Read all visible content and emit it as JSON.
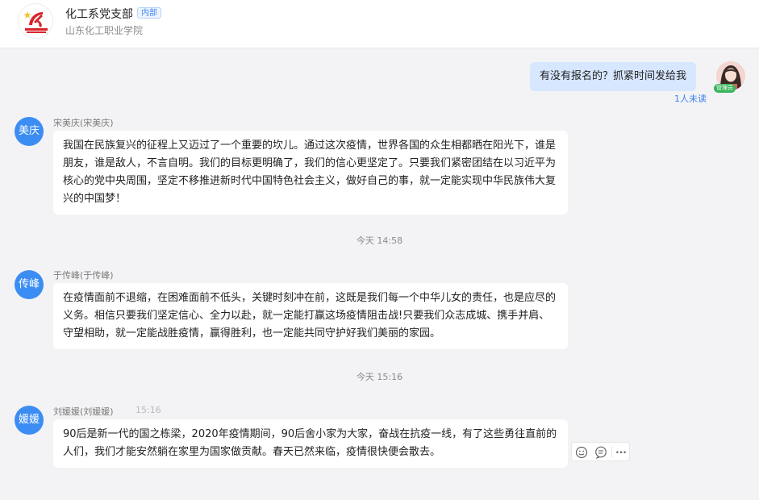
{
  "header": {
    "group_name": "化工系党支部",
    "tag": "内部",
    "org": "山东化工职业学院"
  },
  "self_message": {
    "text": "有没有报名的？抓紧时间发给我",
    "badge": "管理员",
    "unread": "1人未读"
  },
  "messages": [
    {
      "avatar": "美庆",
      "sender": "宋美庆(宋美庆)",
      "time": "",
      "text": "我国在民族复兴的征程上又迈过了一个重要的坎儿。通过这次疫情，世界各国的众生相都晒在阳光下，谁是朋友，谁是敌人，不言自明。我们的目标更明确了，我们的信心更坚定了。只要我们紧密团结在以习近平为核心的党中央周围，坚定不移推进新时代中国特色社会主义，做好自己的事，就一定能实现中华民族伟大复兴的中国梦！"
    },
    {
      "avatar": "传峰",
      "sender": "于传峰(于传峰)",
      "time": "",
      "text": "在疫情面前不退缩，在困难面前不低头，关键时刻冲在前，这既是我们每一个中华儿女的责任，也是应尽的义务。相信只要我们坚定信心、全力以赴，就一定能打赢这场疫情阻击战!只要我们众志成城、携手并肩、守望相助，就一定能战胜疫情，赢得胜利，也一定能共同守护好我们美丽的家园。"
    },
    {
      "avatar": "媛媛",
      "sender": "刘媛媛(刘媛媛)",
      "time": "15:16",
      "text": "90后是新一代的国之栋梁，2020年疫情期间，90后舍小家为大家，奋战在抗疫一线，有了这些勇往直前的人们，我们才能安然躺在家里为国家做贡献。春天已然来临，疫情很快便会散去。"
    }
  ],
  "time_dividers": [
    "今天 14:58",
    "今天 15:16"
  ],
  "actions": {
    "emoji": "emoji-icon",
    "reply": "reply-icon",
    "more": "···"
  },
  "colors": {
    "accent": "#3c8df3",
    "self_bubble": "#d6e7ff",
    "background": "#f3f3f5",
    "badge": "#38b45c"
  }
}
